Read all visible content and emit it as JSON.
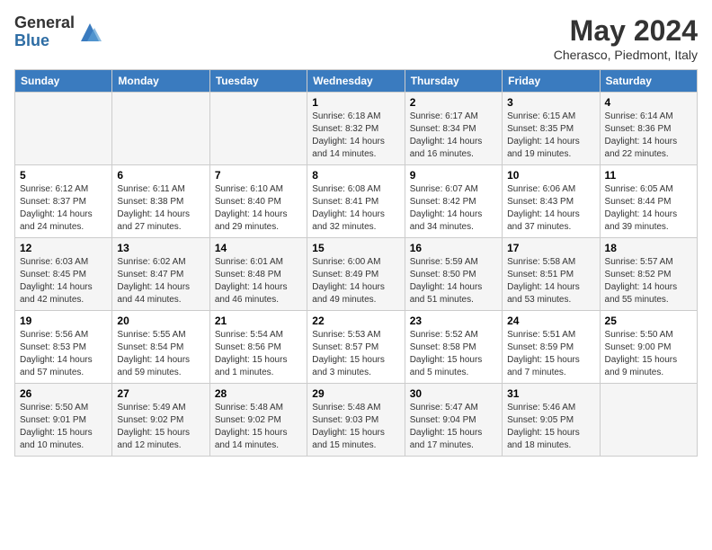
{
  "header": {
    "logo_general": "General",
    "logo_blue": "Blue",
    "month_year": "May 2024",
    "location": "Cherasco, Piedmont, Italy"
  },
  "calendar": {
    "days_of_week": [
      "Sunday",
      "Monday",
      "Tuesday",
      "Wednesday",
      "Thursday",
      "Friday",
      "Saturday"
    ],
    "weeks": [
      [
        {
          "day": "",
          "info": ""
        },
        {
          "day": "",
          "info": ""
        },
        {
          "day": "",
          "info": ""
        },
        {
          "day": "1",
          "info": "Sunrise: 6:18 AM\nSunset: 8:32 PM\nDaylight: 14 hours\nand 14 minutes."
        },
        {
          "day": "2",
          "info": "Sunrise: 6:17 AM\nSunset: 8:34 PM\nDaylight: 14 hours\nand 16 minutes."
        },
        {
          "day": "3",
          "info": "Sunrise: 6:15 AM\nSunset: 8:35 PM\nDaylight: 14 hours\nand 19 minutes."
        },
        {
          "day": "4",
          "info": "Sunrise: 6:14 AM\nSunset: 8:36 PM\nDaylight: 14 hours\nand 22 minutes."
        }
      ],
      [
        {
          "day": "5",
          "info": "Sunrise: 6:12 AM\nSunset: 8:37 PM\nDaylight: 14 hours\nand 24 minutes."
        },
        {
          "day": "6",
          "info": "Sunrise: 6:11 AM\nSunset: 8:38 PM\nDaylight: 14 hours\nand 27 minutes."
        },
        {
          "day": "7",
          "info": "Sunrise: 6:10 AM\nSunset: 8:40 PM\nDaylight: 14 hours\nand 29 minutes."
        },
        {
          "day": "8",
          "info": "Sunrise: 6:08 AM\nSunset: 8:41 PM\nDaylight: 14 hours\nand 32 minutes."
        },
        {
          "day": "9",
          "info": "Sunrise: 6:07 AM\nSunset: 8:42 PM\nDaylight: 14 hours\nand 34 minutes."
        },
        {
          "day": "10",
          "info": "Sunrise: 6:06 AM\nSunset: 8:43 PM\nDaylight: 14 hours\nand 37 minutes."
        },
        {
          "day": "11",
          "info": "Sunrise: 6:05 AM\nSunset: 8:44 PM\nDaylight: 14 hours\nand 39 minutes."
        }
      ],
      [
        {
          "day": "12",
          "info": "Sunrise: 6:03 AM\nSunset: 8:45 PM\nDaylight: 14 hours\nand 42 minutes."
        },
        {
          "day": "13",
          "info": "Sunrise: 6:02 AM\nSunset: 8:47 PM\nDaylight: 14 hours\nand 44 minutes."
        },
        {
          "day": "14",
          "info": "Sunrise: 6:01 AM\nSunset: 8:48 PM\nDaylight: 14 hours\nand 46 minutes."
        },
        {
          "day": "15",
          "info": "Sunrise: 6:00 AM\nSunset: 8:49 PM\nDaylight: 14 hours\nand 49 minutes."
        },
        {
          "day": "16",
          "info": "Sunrise: 5:59 AM\nSunset: 8:50 PM\nDaylight: 14 hours\nand 51 minutes."
        },
        {
          "day": "17",
          "info": "Sunrise: 5:58 AM\nSunset: 8:51 PM\nDaylight: 14 hours\nand 53 minutes."
        },
        {
          "day": "18",
          "info": "Sunrise: 5:57 AM\nSunset: 8:52 PM\nDaylight: 14 hours\nand 55 minutes."
        }
      ],
      [
        {
          "day": "19",
          "info": "Sunrise: 5:56 AM\nSunset: 8:53 PM\nDaylight: 14 hours\nand 57 minutes."
        },
        {
          "day": "20",
          "info": "Sunrise: 5:55 AM\nSunset: 8:54 PM\nDaylight: 14 hours\nand 59 minutes."
        },
        {
          "day": "21",
          "info": "Sunrise: 5:54 AM\nSunset: 8:56 PM\nDaylight: 15 hours\nand 1 minutes."
        },
        {
          "day": "22",
          "info": "Sunrise: 5:53 AM\nSunset: 8:57 PM\nDaylight: 15 hours\nand 3 minutes."
        },
        {
          "day": "23",
          "info": "Sunrise: 5:52 AM\nSunset: 8:58 PM\nDaylight: 15 hours\nand 5 minutes."
        },
        {
          "day": "24",
          "info": "Sunrise: 5:51 AM\nSunset: 8:59 PM\nDaylight: 15 hours\nand 7 minutes."
        },
        {
          "day": "25",
          "info": "Sunrise: 5:50 AM\nSunset: 9:00 PM\nDaylight: 15 hours\nand 9 minutes."
        }
      ],
      [
        {
          "day": "26",
          "info": "Sunrise: 5:50 AM\nSunset: 9:01 PM\nDaylight: 15 hours\nand 10 minutes."
        },
        {
          "day": "27",
          "info": "Sunrise: 5:49 AM\nSunset: 9:02 PM\nDaylight: 15 hours\nand 12 minutes."
        },
        {
          "day": "28",
          "info": "Sunrise: 5:48 AM\nSunset: 9:02 PM\nDaylight: 15 hours\nand 14 minutes."
        },
        {
          "day": "29",
          "info": "Sunrise: 5:48 AM\nSunset: 9:03 PM\nDaylight: 15 hours\nand 15 minutes."
        },
        {
          "day": "30",
          "info": "Sunrise: 5:47 AM\nSunset: 9:04 PM\nDaylight: 15 hours\nand 17 minutes."
        },
        {
          "day": "31",
          "info": "Sunrise: 5:46 AM\nSunset: 9:05 PM\nDaylight: 15 hours\nand 18 minutes."
        },
        {
          "day": "",
          "info": ""
        }
      ]
    ]
  }
}
